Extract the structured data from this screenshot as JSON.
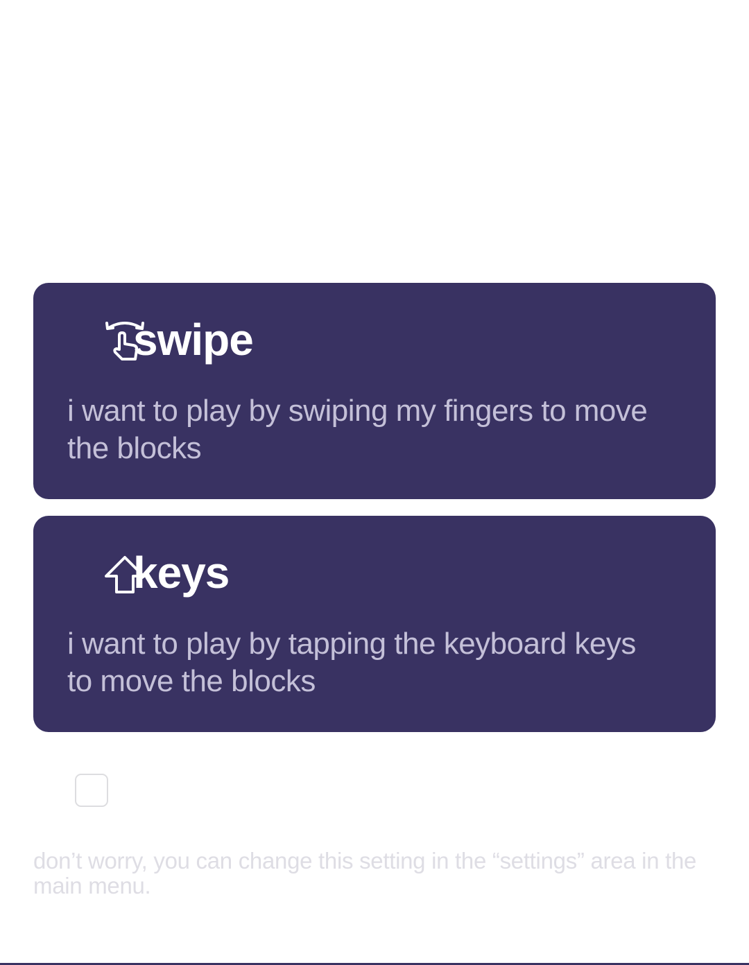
{
  "options": [
    {
      "id": "swipe",
      "icon": "swipe-gesture-icon",
      "title": "swipe",
      "description": "i want to play by swiping my fingers to move the blocks"
    },
    {
      "id": "keys",
      "icon": "arrow-up-key-icon",
      "title": "keys",
      "description": "i want to play by tapping the keyboard keys to move the blocks"
    }
  ],
  "checkbox": {
    "checked": false
  },
  "footnote": "don’t worry, you can change this setting in the “settings” area in the main menu.",
  "colors": {
    "card_background": "#393262",
    "card_title": "#ffffff",
    "card_description": "#c4c0d8",
    "footnote": "#dedde4",
    "checkbox_border": "#dddde0"
  }
}
